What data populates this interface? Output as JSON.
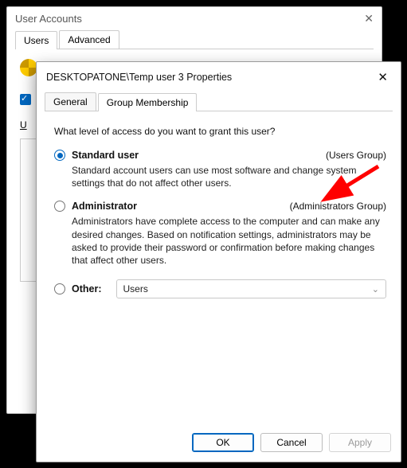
{
  "bg": {
    "title": "User Accounts",
    "tabs": [
      "Users",
      "Advanced"
    ],
    "users_label_u": "U"
  },
  "front": {
    "title": "DESKTOPATONE\\Temp user 3 Properties",
    "tabs": {
      "general": "General",
      "group": "Group Membership"
    },
    "question": "What level of access do you want to grant this user?",
    "standard": {
      "label": "Standard user",
      "group": "(Users Group)",
      "desc": "Standard account users can use most software and change system settings that do not affect other users."
    },
    "admin": {
      "label": "Administrator",
      "group": "(Administrators Group)",
      "desc": "Administrators have complete access to the computer and can make any desired changes. Based on notification settings, administrators may be asked to provide their password or confirmation before making changes that affect other users."
    },
    "other": {
      "label": "Other:",
      "value": "Users"
    },
    "buttons": {
      "ok": "OK",
      "cancel": "Cancel",
      "apply": "Apply"
    }
  }
}
